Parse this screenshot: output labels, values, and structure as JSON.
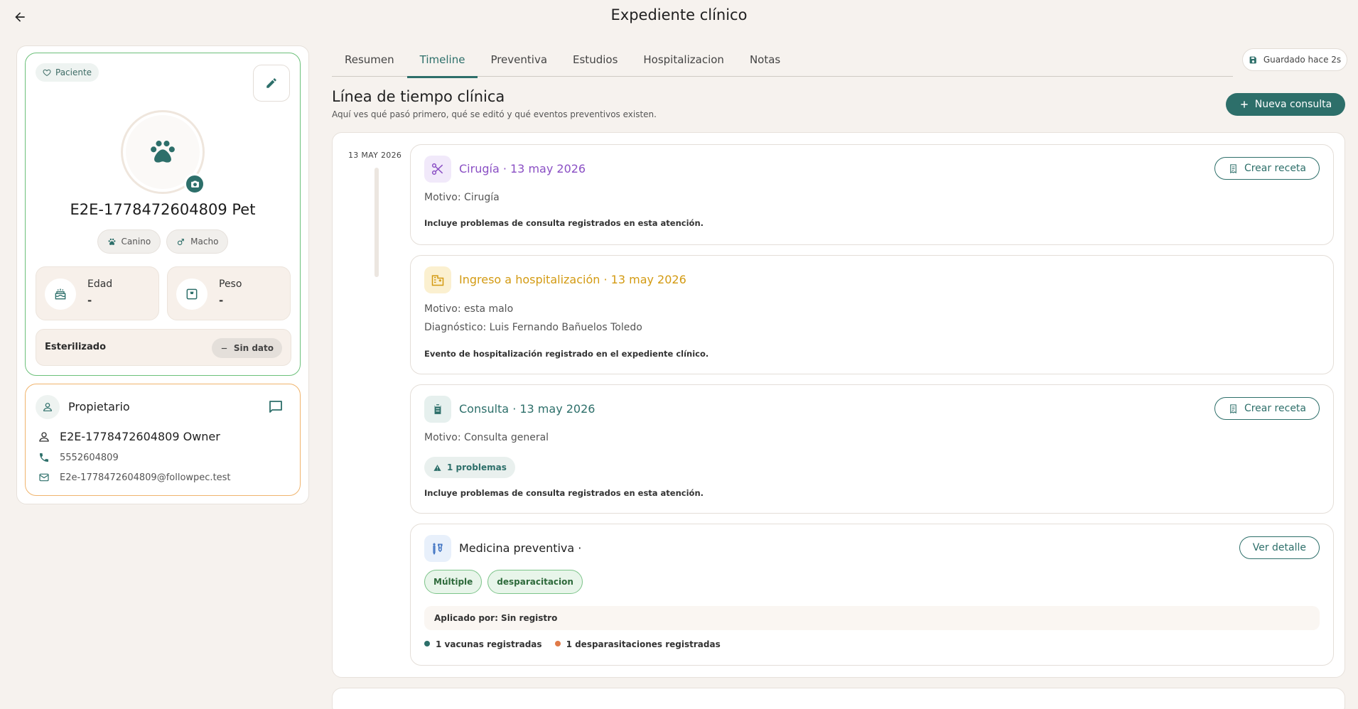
{
  "header": {
    "title": "Expediente clínico"
  },
  "patient": {
    "chip": "Paciente",
    "name": "E2E-1778472604809 Pet",
    "species": "Canino",
    "sex": "Macho",
    "age_label": "Edad",
    "age_value": "-",
    "weight_label": "Peso",
    "weight_value": "-",
    "sterilized_label": "Esterilizado",
    "sterilized_value": "Sin dato"
  },
  "owner": {
    "title": "Propietario",
    "name": "E2E-1778472604809 Owner",
    "phone": "5552604809",
    "email": "E2e-1778472604809@followpec.test"
  },
  "tabs": [
    {
      "label": "Resumen"
    },
    {
      "label": "Timeline",
      "active": true
    },
    {
      "label": "Preventiva"
    },
    {
      "label": "Estudios"
    },
    {
      "label": "Hospitalizacion"
    },
    {
      "label": "Notas"
    }
  ],
  "saved_status": "Guardado hace 2s",
  "timeline": {
    "title": "Línea de tiempo clínica",
    "subtitle": "Aquí ves qué pasó primero, qué se editó y qué eventos preventivos existen.",
    "new_button": "Nueva consulta",
    "date": "13 MAY 2026",
    "events": [
      {
        "title": "Cirugía · 13 may 2026",
        "reason": "Motivo: Cirugía",
        "note": "Incluye problemas de consulta registrados en esta atención.",
        "action": "Crear receta",
        "color": "#8a4fc4"
      },
      {
        "title": "Ingreso a hospitalización · 13 may 2026",
        "reason": "Motivo: esta malo",
        "diagnosis": "Diagnóstico: Luis Fernando Bañuelos Toledo",
        "note": "Evento de hospitalización registrado en el expediente clínico.",
        "color": "#d39a12"
      },
      {
        "title": "Consulta · 13 may 2026",
        "reason": "Motivo: Consulta general",
        "problems": "1 problemas",
        "note": "Incluye problemas de consulta registrados en esta atención.",
        "action": "Crear receta",
        "color": "#2d6f6a"
      },
      {
        "title": "Medicina preventiva ·",
        "tags": [
          "Múltiple",
          "desparacitacion"
        ],
        "applied_by": "Aplicado por: Sin registro",
        "vaccines": "1 vacunas registradas",
        "deworming": "1 desparasitaciones registradas",
        "action": "Ver detalle",
        "color": "#222222"
      }
    ]
  },
  "colors": {
    "accent": "#2d6f6a",
    "patient_border": "#6cc07a",
    "owner_border": "#f0b46d",
    "vaccine_dot": "#2d6f6a",
    "deworm_dot": "#e07a48"
  }
}
